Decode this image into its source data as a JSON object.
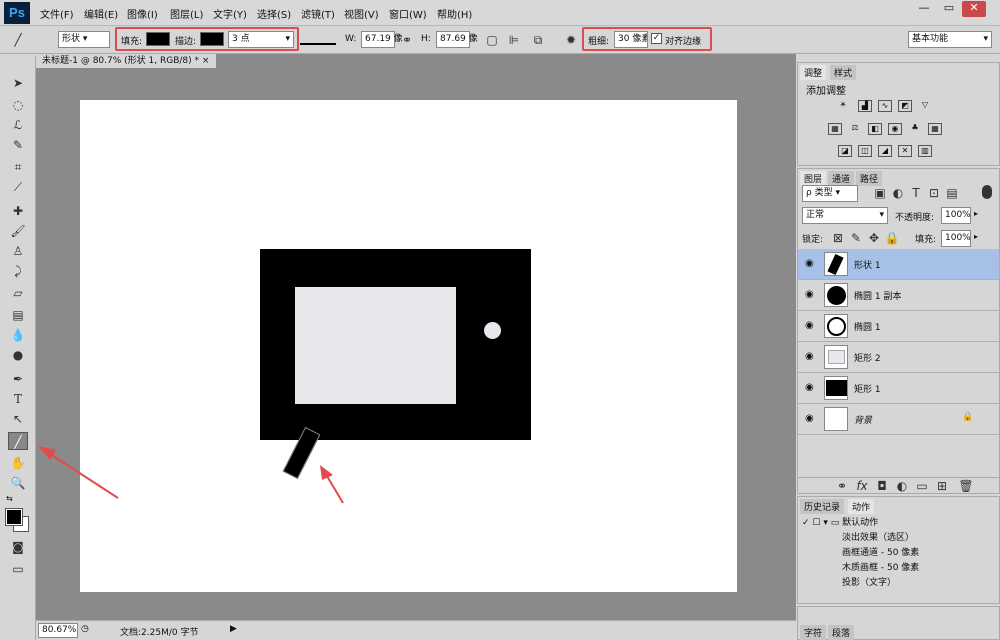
{
  "app": {
    "logo": "Ps"
  },
  "menu": [
    "文件(F)",
    "编辑(E)",
    "图像(I)",
    "图层(L)",
    "文字(Y)",
    "选择(S)",
    "滤镜(T)",
    "视图(V)",
    "窗口(W)",
    "帮助(H)"
  ],
  "window_controls": {
    "minimize": "—",
    "restore": "▭",
    "close": "✕"
  },
  "options": {
    "mode": "形状",
    "fill_label": "填充:",
    "stroke_label": "描边:",
    "stroke_width": "3 点",
    "w_label": "W:",
    "w_value": "67.19 像",
    "h_label": "H:",
    "h_value": "87.69 像",
    "weight_label": "粗细:",
    "weight_value": "30 像素",
    "align_edges": "对齐边缘",
    "workspace": "基本功能"
  },
  "document": {
    "tab_title": "未标题-1 @ 80.7% (形状 1, RGB/8) *",
    "close": "×"
  },
  "status": {
    "zoom": "80.67%",
    "doc_size": "文档:2.25M/0 字节"
  },
  "adjustments": {
    "tabs": [
      "调整",
      "样式"
    ],
    "heading": "添加调整"
  },
  "layers_panel": {
    "tabs": [
      "图层",
      "通道",
      "路径"
    ],
    "filter_kind": "ρ 类型",
    "blend_mode": "正常",
    "opacity_label": "不透明度:",
    "opacity_value": "100%",
    "lock_label": "锁定:",
    "fill_label": "填充:",
    "fill_value": "100%",
    "layers": [
      {
        "name": "形状 1",
        "selected": true
      },
      {
        "name": "椭圆 1 副本",
        "selected": false
      },
      {
        "name": "椭圆 1",
        "selected": false
      },
      {
        "name": "矩形 2",
        "selected": false
      },
      {
        "name": "矩形 1",
        "selected": false
      },
      {
        "name": "背景",
        "selected": false
      }
    ]
  },
  "history_panel": {
    "tabs": [
      "历史记录",
      "动作"
    ],
    "items": [
      "默认动作",
      "淡出效果（选区）",
      "画框通道 - 50 像素",
      "木质画框 - 50 像素",
      "投影（文字）"
    ]
  },
  "bottom_panel": {
    "tabs": [
      "字符",
      "段落"
    ]
  },
  "colors": {
    "accent_red": "#e24b4b",
    "layer_selected": "#a6c0e8",
    "canvas_inner": "#e9e7ec"
  }
}
